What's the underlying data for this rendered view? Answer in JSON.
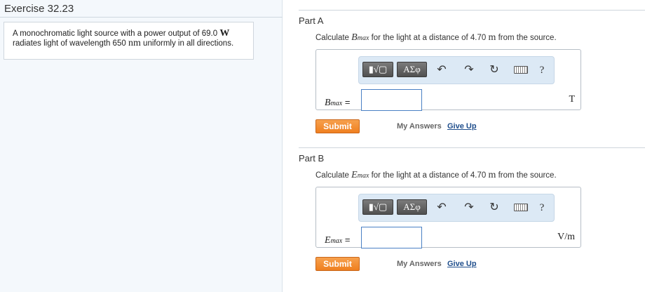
{
  "exercise": {
    "title": "Exercise 32.23"
  },
  "problem": {
    "t1": "A monochromatic light source with a power output of 69.0",
    "u1": "W",
    "t2": "radiates light of wavelength 650",
    "u2": "nm",
    "t3": "uniformly in all directions."
  },
  "parts": [
    {
      "title": "Part A",
      "q_pre": "Calculate",
      "q_var": "B",
      "q_sub": "max",
      "q_mid": "for the light at a distance of 4.70",
      "q_unit": "m",
      "q_post": "from the source.",
      "label_var": "B",
      "label_sub": "max",
      "label_eq": "=",
      "answer_value": "",
      "unit": "T",
      "submit": "Submit",
      "my_answers": "My Answers",
      "give_up": "Give Up"
    },
    {
      "title": "Part B",
      "q_pre": "Calculate",
      "q_var": "E",
      "q_sub": "max",
      "q_mid": "for the light at a distance of 4.70",
      "q_unit": "m",
      "q_post": "from the source.",
      "label_var": "E",
      "label_sub": "max",
      "label_eq": "=",
      "answer_value": "",
      "unit": "V/m",
      "submit": "Submit",
      "my_answers": "My Answers",
      "give_up": "Give Up"
    }
  ],
  "toolbar": {
    "templates_label": "▮√▢",
    "symbols_label": "ΑΣφ",
    "undo_glyph": "↶",
    "redo_glyph": "↷",
    "reset_glyph": "↻",
    "help_label": "?",
    "icons": [
      "templates-icon",
      "symbols-icon",
      "undo-icon",
      "redo-icon",
      "reset-icon",
      "keyboard-icon",
      "help-icon"
    ]
  },
  "colors": {
    "submit_bg": "#ef7f1f",
    "link": "#1f4e8c",
    "toolbar_bg": "#dce9f5",
    "input_border": "#4a80c4"
  }
}
